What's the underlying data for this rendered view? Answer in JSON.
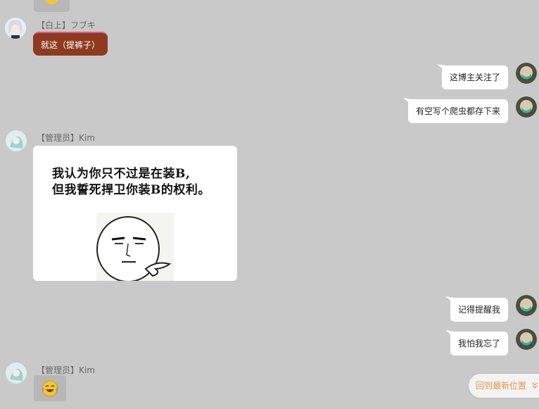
{
  "chat": {
    "messages": [
      {
        "side": "left",
        "sender": "【白上】フブキ",
        "text": "就这（提裤子）"
      },
      {
        "side": "right",
        "text": "这博主关注了"
      },
      {
        "side": "right",
        "text": "有空写个爬虫都存下来"
      },
      {
        "side": "left",
        "sender": "【管理员】Kim",
        "image_text_1": "我认为你只不过是在装B,",
        "image_text_2": "但我誓死捍卫你装B的权利。"
      },
      {
        "side": "right",
        "text": "记得提醒我"
      },
      {
        "side": "right",
        "text": "我怕我忘了"
      },
      {
        "side": "left",
        "sender": "【管理员】Kim",
        "emoji": "laughing-crying-emoji"
      }
    ]
  },
  "return_latest": {
    "label": "回到最新位置",
    "icon": "double-chevron-down-icon"
  },
  "colors": {
    "background": "#c9c9c9",
    "fubuki_bubble": "#8e3a1e",
    "return_text": "#e8944a"
  }
}
